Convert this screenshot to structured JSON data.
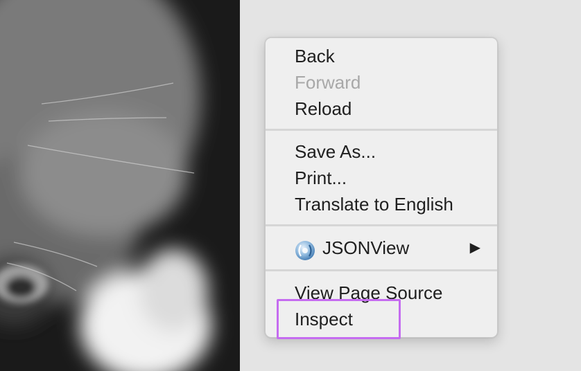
{
  "menu": {
    "items": {
      "back": "Back",
      "forward": "Forward",
      "reload": "Reload",
      "save_as": "Save As...",
      "print": "Print...",
      "translate": "Translate to English",
      "jsonview": "JSONView",
      "view_source": "View Page Source",
      "inspect": "Inspect"
    },
    "jsonview_icon": "jsonview-icon",
    "submenu_arrow_icon": "submenu-arrow-icon"
  },
  "colors": {
    "menu_background": "#efefef",
    "disabled_text": "#a8a8a8",
    "highlight_border": "#c56cf0"
  }
}
